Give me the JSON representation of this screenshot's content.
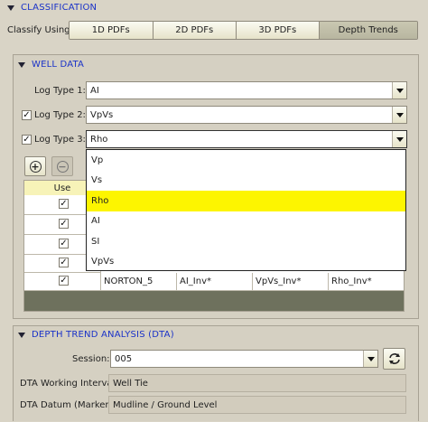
{
  "classification": {
    "title": "CLASSIFICATION",
    "classify_label": "Classify Using:",
    "tabs": [
      "1D PDFs",
      "2D PDFs",
      "3D PDFs",
      "Depth Trends"
    ],
    "active_tab": "Depth Trends"
  },
  "well_data": {
    "title": "WELL DATA",
    "log_types": [
      {
        "label": "Log Type 1:",
        "value": "AI",
        "checked": false
      },
      {
        "label": "Log Type 2:",
        "value": "VpVs",
        "checked": true
      },
      {
        "label": "Log Type 3:",
        "value": "Rho",
        "checked": true
      }
    ],
    "add_icon": "plus-circle-icon",
    "remove_icon": "minus-circle-icon",
    "table": {
      "use_header": "Use",
      "use_checked": [
        true,
        true,
        true,
        true,
        true
      ],
      "last_row": [
        "NORTON_5",
        "AI_Inv*",
        "VpVs_Inv*",
        "Rho_Inv*"
      ]
    },
    "dropdown_options": [
      "Vp",
      "Vs",
      "Rho",
      "AI",
      "SI",
      "VpVs"
    ],
    "dropdown_selected": "Rho"
  },
  "dta": {
    "title": "DEPTH TREND ANALYSIS (DTA)",
    "session_label": "Session:",
    "session_value": "005",
    "refresh_icon": "refresh-icon",
    "interval_label": "DTA Working Interval:",
    "interval_value": "Well Tie",
    "datum_label": "DTA Datum (Marker):",
    "datum_value": "Mudline / Ground Level"
  },
  "colors": {
    "header_text": "#1a32c8",
    "highlight": "#fdf500",
    "table_header": "#f7f3b8",
    "table_footer": "#6e715d"
  }
}
